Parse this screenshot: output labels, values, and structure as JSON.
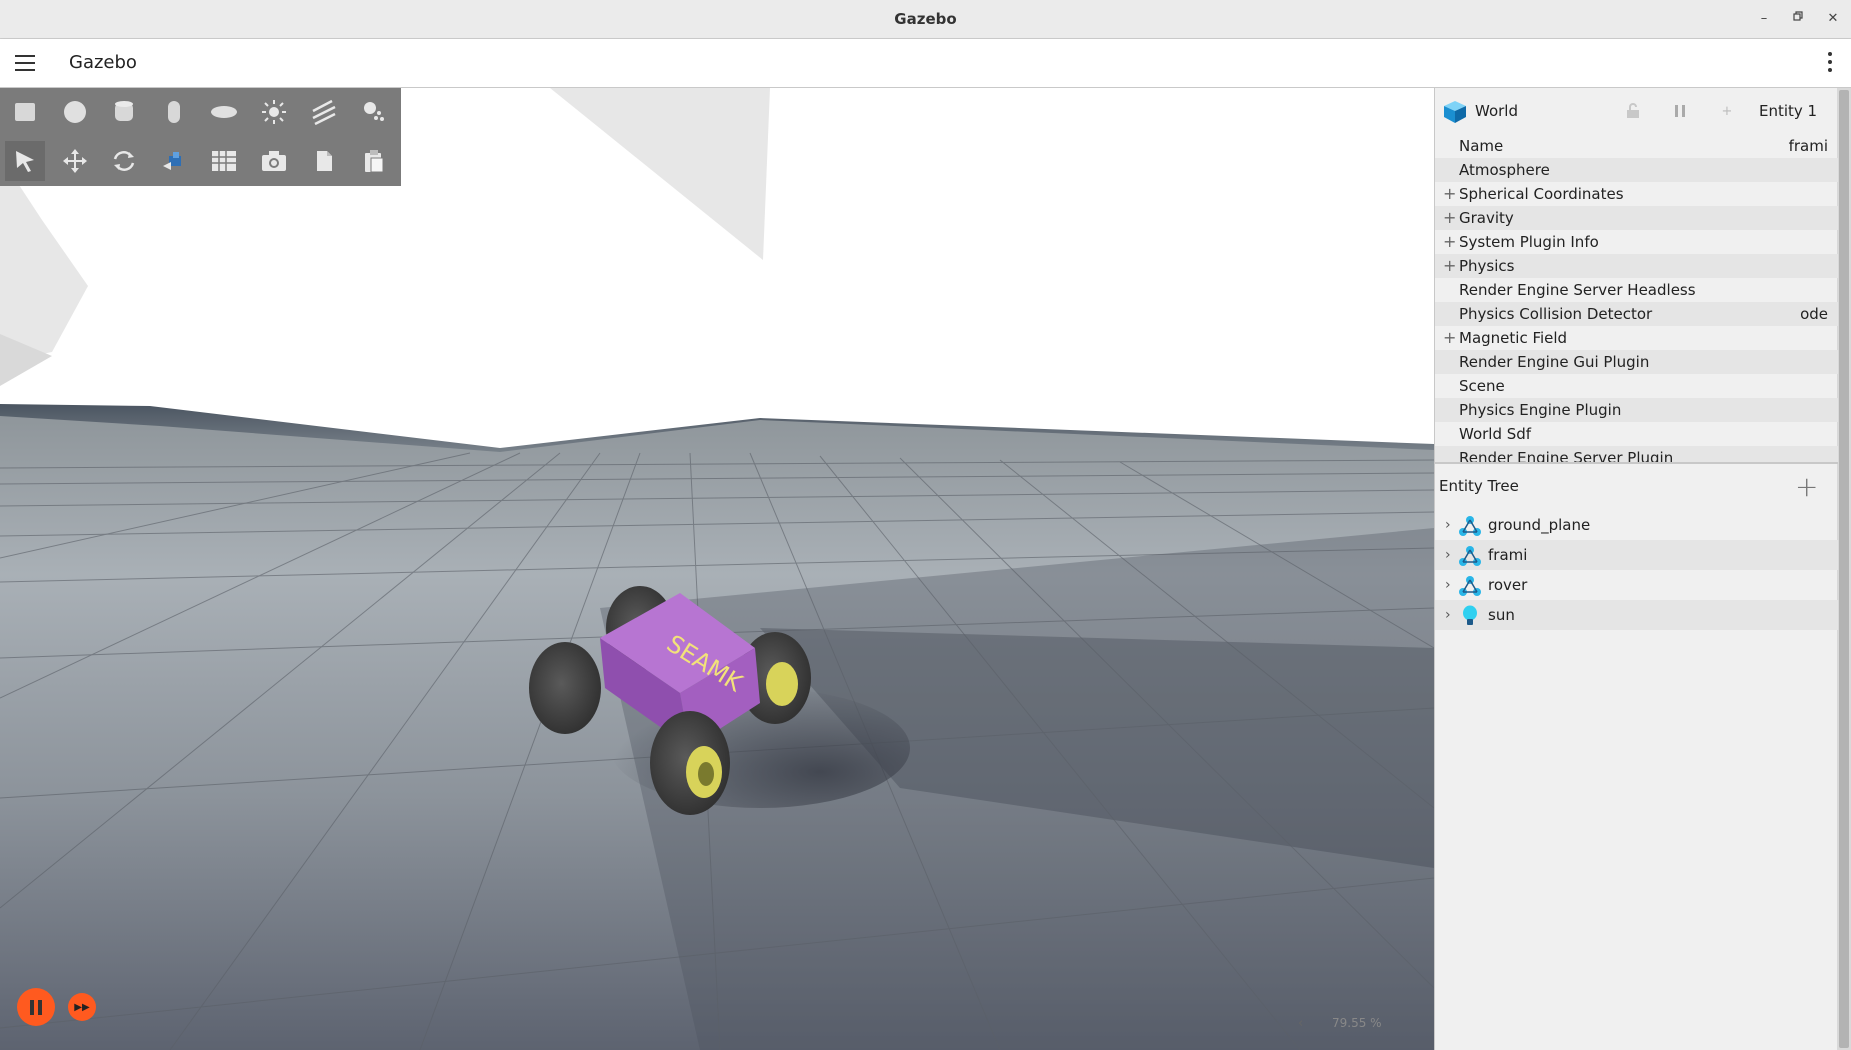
{
  "window": {
    "title": "Gazebo"
  },
  "app": {
    "title": "Gazebo"
  },
  "component_inspector": {
    "entity_name": "World",
    "entity_id": "Entity 1",
    "properties": [
      {
        "label": "Name",
        "value": "frami",
        "expandable": false
      },
      {
        "label": "Atmosphere",
        "value": "",
        "expandable": false
      },
      {
        "label": "Spherical Coordinates",
        "value": "",
        "expandable": true
      },
      {
        "label": "Gravity",
        "value": "",
        "expandable": true
      },
      {
        "label": "System Plugin Info",
        "value": "",
        "expandable": true
      },
      {
        "label": "Physics",
        "value": "",
        "expandable": true
      },
      {
        "label": "Render Engine Server Headless",
        "value": "",
        "expandable": false
      },
      {
        "label": "Physics Collision Detector",
        "value": "ode",
        "expandable": false
      },
      {
        "label": "Magnetic Field",
        "value": "",
        "expandable": true
      },
      {
        "label": "Render Engine Gui Plugin",
        "value": "",
        "expandable": false
      },
      {
        "label": "Scene",
        "value": "",
        "expandable": false
      },
      {
        "label": "Physics Engine Plugin",
        "value": "",
        "expandable": false
      },
      {
        "label": "World Sdf",
        "value": "",
        "expandable": false
      },
      {
        "label": "Render Engine Server Plugin",
        "value": "",
        "expandable": false
      }
    ]
  },
  "entity_tree": {
    "title": "Entity Tree",
    "items": [
      {
        "label": "ground_plane",
        "icon": "model-icon"
      },
      {
        "label": "frami",
        "icon": "model-icon"
      },
      {
        "label": "rover",
        "icon": "model-icon"
      },
      {
        "label": "sun",
        "icon": "light-icon"
      }
    ]
  },
  "viewport": {
    "rover_label": "SEAMK",
    "rtf": "79.55 %"
  },
  "colors": {
    "accent": "#ff5a1f",
    "rover_body": "#a35fc0",
    "toolbar_bg": "#7b7b7b",
    "panel_bg": "#f0f0f0"
  }
}
